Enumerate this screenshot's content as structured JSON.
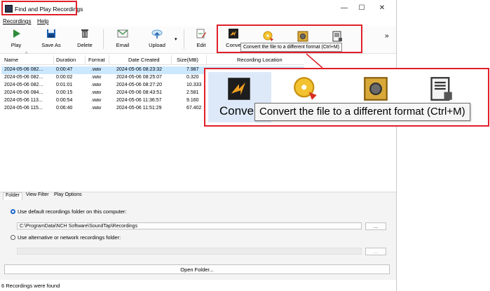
{
  "window": {
    "title": "Find and Play Recordings",
    "controls": {
      "minimize": "—",
      "maximize": "☐",
      "close": "✕"
    }
  },
  "menu": {
    "items": [
      {
        "label": "Recordings"
      },
      {
        "label": "Help"
      }
    ]
  },
  "toolbar": {
    "buttons": [
      {
        "label": "Play",
        "icon": "play-icon"
      },
      {
        "label": "Save As",
        "icon": "save-icon"
      },
      {
        "label": "Delete",
        "icon": "trash-icon"
      },
      {
        "label": "Email",
        "icon": "email-icon"
      },
      {
        "label": "Upload",
        "icon": "upload-icon"
      },
      {
        "label": "Edit",
        "icon": "edit-icon"
      },
      {
        "label": "Conve",
        "icon": "convert-icon"
      }
    ],
    "tooltip": "Convert the file to a different format (Ctrl+M)",
    "overflow": "»",
    "upload_arrow": "▾"
  },
  "list": {
    "sort_indicator": "^",
    "columns": [
      "Name",
      "Duration",
      "Format",
      "Date Created",
      "Size(MB)",
      "Recording Location"
    ],
    "rows": [
      {
        "name": "2024-05-06 082...",
        "duration": "0:00:47",
        "format": ".wav",
        "date": "2024-05-06 08:23:32",
        "size": "7.987"
      },
      {
        "name": "2024-05-06 082...",
        "duration": "0:00:02",
        "format": ".wav",
        "date": "2024-05-06 08:25:07",
        "size": "0.320"
      },
      {
        "name": "2024-05-06 082...",
        "duration": "0:01:01",
        "format": ".wav",
        "date": "2024-05-06 08:27:20",
        "size": "10.333"
      },
      {
        "name": "2024-05-06 084...",
        "duration": "0:00:15",
        "format": ".wav",
        "date": "2024-05-06 08:43:51",
        "size": "2.581"
      },
      {
        "name": "2024-05-06 113...",
        "duration": "0:00:54",
        "format": ".wav",
        "date": "2024-05-06 11:36:57",
        "size": "9.160"
      },
      {
        "name": "2024-05-06 115...",
        "duration": "0:06:40",
        "format": ".wav",
        "date": "2024-05-06 11:51:29",
        "size": "67.402"
      }
    ]
  },
  "tabs": [
    {
      "label": "Folder"
    },
    {
      "label": "View Filter"
    },
    {
      "label": "Play Options"
    }
  ],
  "folder": {
    "default_option": "Use default recordings folder on this computer:",
    "default_path": "C:\\ProgramData\\NCH Software\\SoundTap\\Recordings",
    "browse": "...",
    "alt_option": "Use alternative or network recordings folder:",
    "alt_browse": "...",
    "open_folder": "Open Folder..."
  },
  "status": "6 Recordings were found",
  "zoom": {
    "label": "Conve",
    "tooltip": "Convert the file to a different format (Ctrl+M)"
  },
  "colors": {
    "highlight": "#e0202a",
    "selection": "#cce8ff",
    "accent": "#1a63c7"
  }
}
